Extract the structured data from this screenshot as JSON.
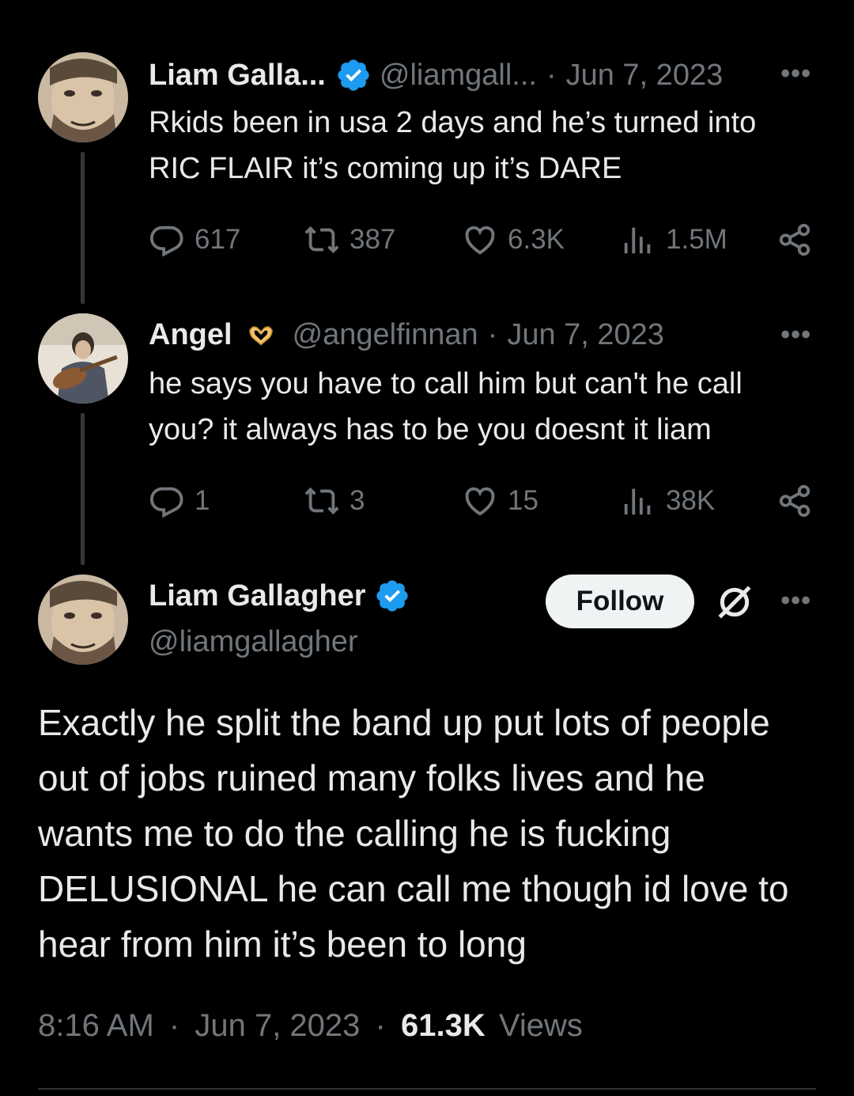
{
  "tweet1": {
    "name": "Liam Galla...",
    "handle": "@liamgall...",
    "separator": "·",
    "date": "Jun 7, 2023",
    "text_line1": "Rkids been in usa 2 days and he’s turned into",
    "text_line2": "RIC FLAIR it’s coming up it’s DARE",
    "replies": "617",
    "reposts": "387",
    "likes": "6.3K",
    "views": "1.5M"
  },
  "tweet2": {
    "name": "Angel",
    "emoji_icon": "heart-hands-emoji",
    "handle": "@angelfinnan",
    "separator": "·",
    "date": "Jun 7, 2023",
    "text_line1": "he says you have to call him but can't he call",
    "text_line2": "you? it always has to be you doesnt it liam",
    "replies": "1",
    "reposts": "3",
    "likes": "15",
    "views": "38K"
  },
  "main": {
    "name": "Liam Gallagher",
    "handle": "@liamgallagher",
    "follow_label": "Follow",
    "text_lines": [
      "Exactly he split the band up put lots of people",
      "out of jobs ruined many folks lives and he",
      "wants me to do the calling he is fucking",
      "DELUSIONAL he can call me though id love to",
      "hear from him it’s been to long"
    ],
    "time": "8:16 AM",
    "date": "Jun 7, 2023",
    "separator": "·",
    "views_count": "61.3K",
    "views_label": "Views"
  },
  "more_label": "•••",
  "colors": {
    "background": "#000000",
    "text": "#e7e9ea",
    "muted": "#71767b",
    "verified": "#1d9bf0",
    "thread_line": "#333639"
  },
  "icons": [
    "reply-icon",
    "repost-icon",
    "like-icon",
    "views-icon",
    "share-icon",
    "verified-badge-icon",
    "grok-icon"
  ]
}
